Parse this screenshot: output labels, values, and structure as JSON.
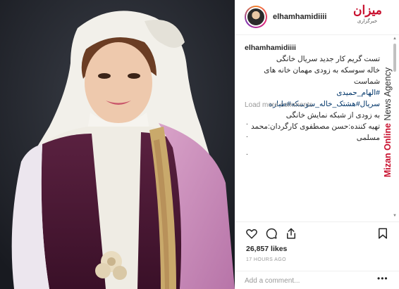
{
  "post": {
    "username": "elhamhamidiiii",
    "caption": {
      "username": "elhamhamidiiii",
      "lines": [
        "تست گریم کار جدید سریال خانگی",
        "خاله سوسکه به زودی مهمان خانه های شماست",
        "#الهام_حمیدی",
        "سریال#هشتک_خاله_سوسکه#طیاره",
        "به زودی از شبکه نمایش خانگی",
        "تهیه کننده:حسن مصطفوی کارگردان:محمد مسلمی"
      ]
    },
    "load_more": "Load more comments",
    "likes": "26,857 likes",
    "timestamp": "17 HOURS AGO",
    "comment_placeholder": "Add a comment...",
    "more_label": "•••"
  },
  "agency": {
    "logo_mark": "میزان",
    "logo_sub": "خبرگزاری",
    "watermark_brand": "Mizan Online",
    "watermark_rest": " News Agency"
  },
  "icons": {
    "like": "heart-icon",
    "comment": "comment-icon",
    "share": "share-icon",
    "save": "bookmark-icon"
  },
  "colors": {
    "brand_red": "#c8102e",
    "text": "#262626",
    "muted": "#999999",
    "background_photo": "#23262e"
  }
}
